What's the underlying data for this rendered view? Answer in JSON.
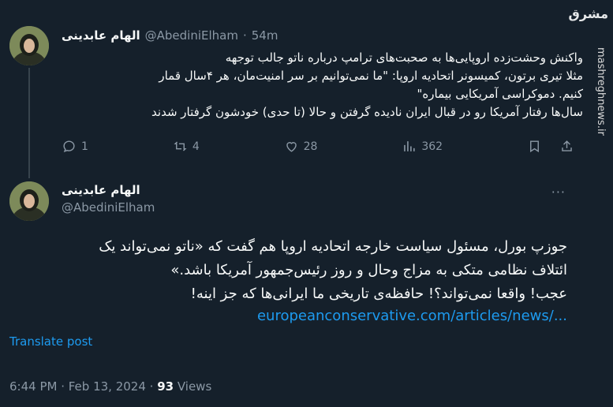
{
  "tweet1": {
    "author_name": "الهام عابدینی",
    "handle": "@AbediniElham",
    "separator": "·",
    "time": "54m",
    "lines": [
      "واکنش وحشت‌زده اروپایی‌ها به صحبت‌های ترامپ درباره ناتو جالب توجهه",
      "مثلا تیری برتون، کمیسونر اتحادیه اروپا: \"ما نمی‌توانیم بر سر امنیت‌مان، هر ۴سال قمار",
      "کنیم. دموکراسی آمریکایی بیماره\"",
      "سال‌ها رفتار آمریکا رو در قبال ایران نادیده گرفتن و حالا (تا حدی) خودشون گرفتار شدند"
    ],
    "actions": {
      "replies": "1",
      "reposts": "4",
      "likes": "28",
      "views": "362"
    }
  },
  "tweet2": {
    "author_name": "الهام عابدینی",
    "handle": "@AbediniElham",
    "more": "···",
    "lines": [
      "جوزپ بورل، مسئول سیاست خارجه اتحادیه اروپا هم گفت که «ناتو نمی‌تواند یک",
      "ائتلاف نظامی متکی به مزاج وحال و روز رئیس‌جمهور آمریکا باشد.»",
      "عجب! واقعا نمی‌تواند؟! حافظه‌ی تاریخی ما ایرانی‌ها که جز اینه!"
    ],
    "link": "europeanconservative.com/articles/news/...",
    "translate": "Translate post",
    "timestamp": "6:44 PM · Feb 13, 2024 ·",
    "views_count": "93",
    "views_label": "Views"
  },
  "watermark": {
    "logo": "مشرق",
    "url": "mashreghnews.ir"
  },
  "colors": {
    "background": "#15202b",
    "accent": "#1d9bf0",
    "muted": "#8b98a5"
  }
}
